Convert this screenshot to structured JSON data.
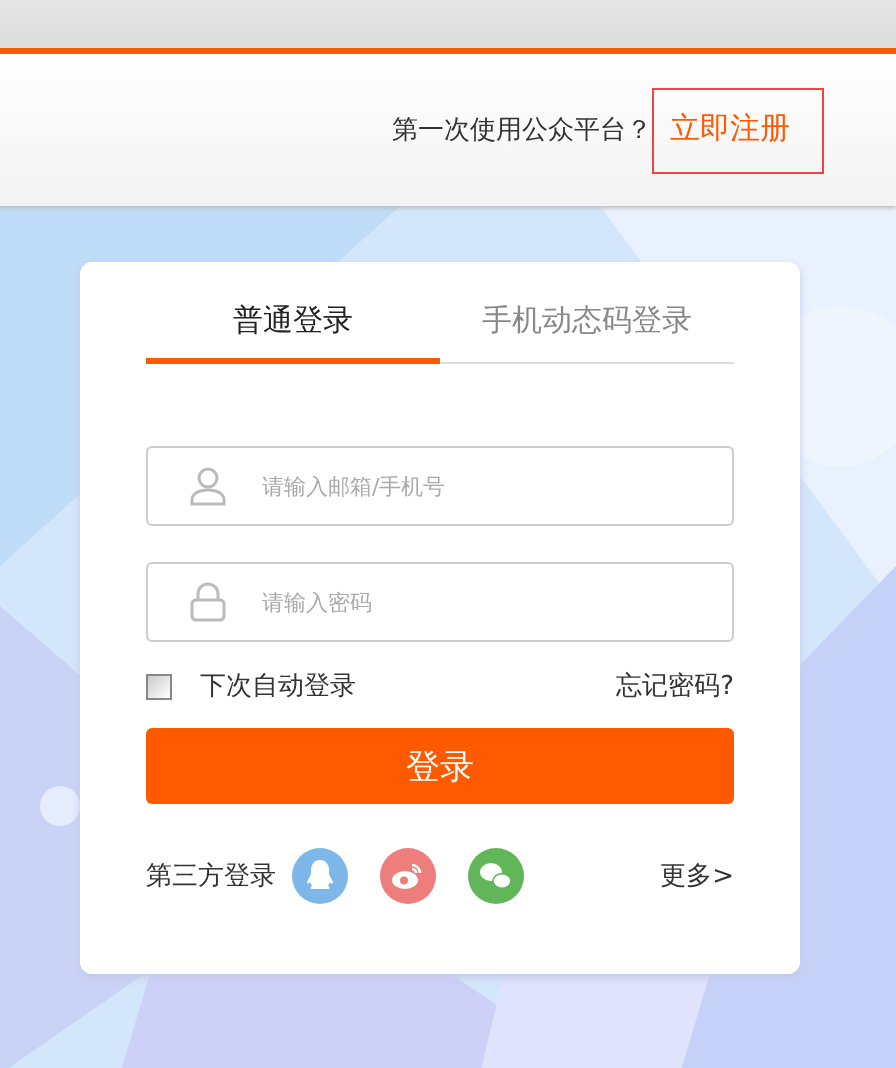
{
  "header": {
    "prompt": "第一次使用公众平台？",
    "register_link": "立即注册"
  },
  "login": {
    "tabs": [
      {
        "label": "普通登录",
        "selected": true
      },
      {
        "label": "手机动态码登录",
        "selected": false
      }
    ],
    "fields": [
      {
        "kind": "account",
        "placeholder": "请输入邮箱/手机号"
      },
      {
        "kind": "password",
        "placeholder": "请输入密码"
      }
    ],
    "remember": {
      "label": "下次自动登录",
      "checked": false
    },
    "forgot_link": "忘记密码?",
    "submit": "登录",
    "third_party": {
      "label": "第三方登录",
      "providers": [
        {
          "kind": "qq"
        },
        {
          "kind": "weibo"
        },
        {
          "kind": "wechat"
        }
      ],
      "more": "更多>"
    }
  }
}
